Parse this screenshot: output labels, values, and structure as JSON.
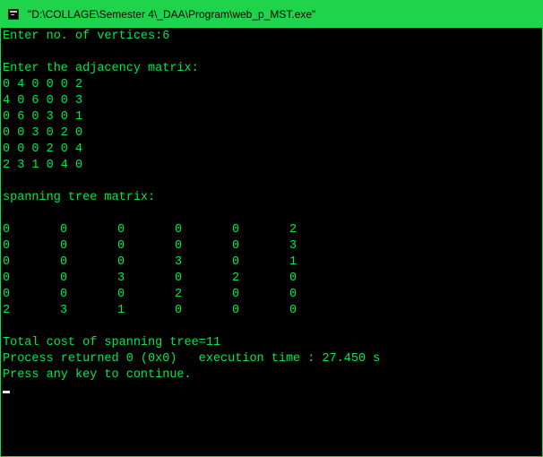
{
  "window": {
    "title": "\"D:\\COLLAGE\\Semester 4\\_DAA\\Program\\web_p_MST.exe\"",
    "icon": "console-app-icon",
    "titlebar_color": "#1fd34a",
    "text_color": "#00e74a"
  },
  "console": {
    "prompt_vertices": "Enter no. of vertices:6",
    "prompt_matrix": "Enter the adjacency matrix:",
    "adjacency_rows": [
      "0 4 0 0 0 2",
      "4 0 6 0 0 3",
      "0 6 0 3 0 1",
      "0 0 3 0 2 0",
      "0 0 0 2 0 4",
      "2 3 1 0 4 0"
    ],
    "spanning_heading": "spanning tree matrix:",
    "spanning_rows": [
      [
        "0",
        "0",
        "0",
        "0",
        "0",
        "2"
      ],
      [
        "0",
        "0",
        "0",
        "0",
        "0",
        "3"
      ],
      [
        "0",
        "0",
        "0",
        "3",
        "0",
        "1"
      ],
      [
        "0",
        "0",
        "3",
        "0",
        "2",
        "0"
      ],
      [
        "0",
        "0",
        "0",
        "2",
        "0",
        "0"
      ],
      [
        "2",
        "3",
        "1",
        "0",
        "0",
        "0"
      ]
    ],
    "total_cost": "Total cost of spanning tree=11",
    "process_returned": "Process returned 0 (0x0)   execution time : 27.450 s",
    "press_key": "Press any key to continue."
  }
}
